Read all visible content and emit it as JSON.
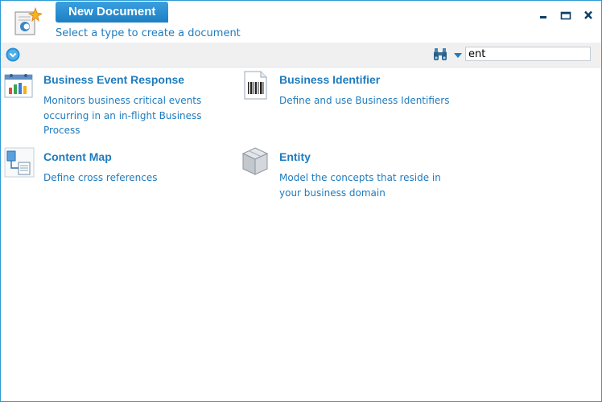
{
  "window": {
    "title": "New Document",
    "subtitle": "Select a type to create a document",
    "controls": {
      "minimize": "minimize-icon",
      "maximize": "maximize-icon",
      "close": "close-icon"
    }
  },
  "toolbar": {
    "nav_icon": "circle-chevron-down-icon",
    "search_icon": "binoculars-icon",
    "search_value": "ent"
  },
  "documents": [
    {
      "name": "Business Event Response",
      "description": "Monitors business critical events occurring in an in-flight Business Process",
      "icon": "calendar-chart-icon"
    },
    {
      "name": "Business Identifier",
      "description": "Define and use Business Identifiers",
      "icon": "barcode-icon"
    },
    {
      "name": "Content Map",
      "description": "Define cross references",
      "icon": "content-map-icon"
    },
    {
      "name": "Entity",
      "description": "Model the concepts that reside in your business domain",
      "icon": "cube-icon"
    }
  ],
  "colors": {
    "accent": "#1f7bbd",
    "border": "#2e9ad6",
    "toolbar_bg": "#f0f0f0"
  }
}
